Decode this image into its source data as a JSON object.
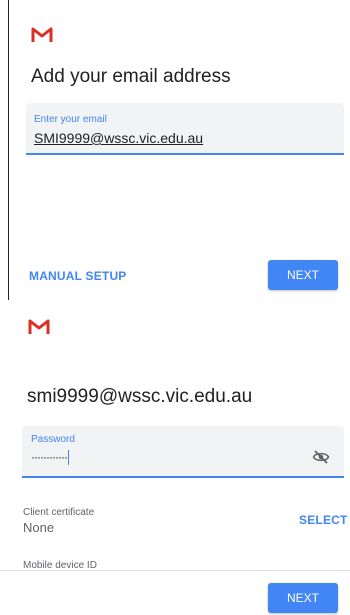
{
  "screen1": {
    "title": "Add your email address",
    "email_field": {
      "label": "Enter your email",
      "value": "SMI9999@wssc.vic.edu.au"
    },
    "manual_setup_label": "MANUAL SETUP",
    "next_label": "NEXT"
  },
  "screen2": {
    "account": "smi9999@wssc.vic.edu.au",
    "password_field": {
      "label": "Password",
      "value": "············"
    },
    "client_certificate": {
      "label": "Client certificate",
      "value": "None",
      "select_label": "SELECT"
    },
    "mobile_device_id_label": "Mobile device ID",
    "next_label": "NEXT"
  },
  "icons": {
    "logo": "gmail-logo-icon",
    "visibility": "visibility-off-icon"
  },
  "colors": {
    "accent": "#4285f4",
    "gmail_red": "#d93025",
    "field_bg": "#f1f3f4"
  }
}
